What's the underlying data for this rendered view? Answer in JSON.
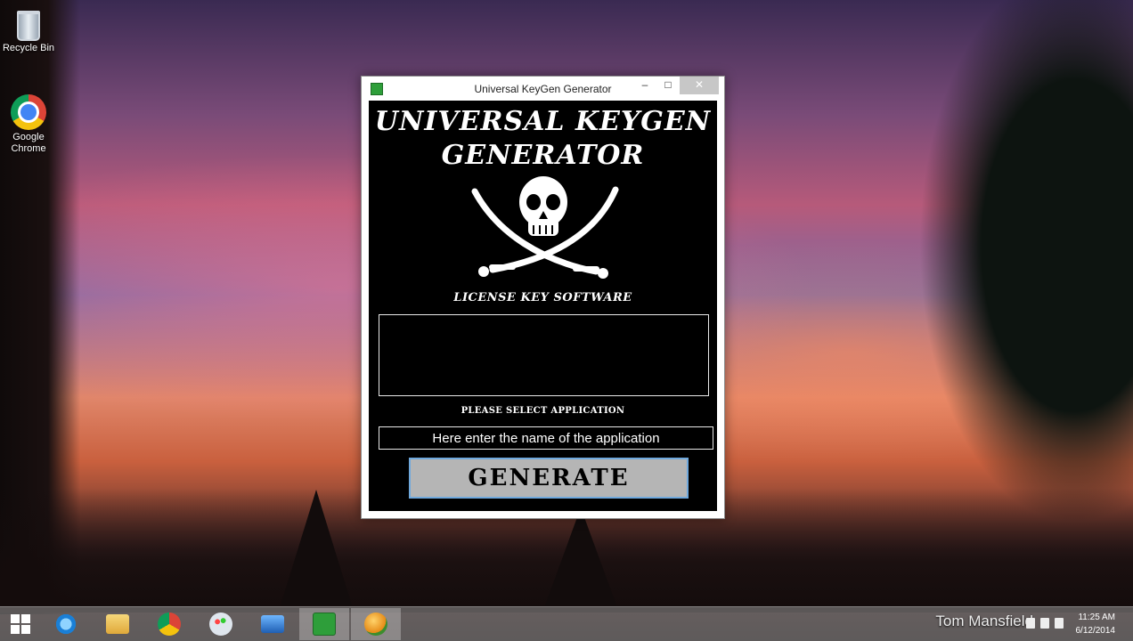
{
  "desktop": {
    "icons": [
      {
        "label": "Recycle Bin",
        "icon": "recycle-bin-icon"
      },
      {
        "label": "Google Chrome",
        "icon": "chrome-icon"
      }
    ]
  },
  "window": {
    "title": "Universal KeyGen Generator",
    "controls": {
      "minimize": "–",
      "maximize": "□",
      "close": "✕"
    },
    "logo_line1": "UNIVERSAL KEYGEN",
    "logo_line2": "GENERATOR",
    "logo_tagline": "LICENSE KEY SOFTWARE",
    "output_value": "",
    "select_label": "PLEASE SELECT APPLICATION",
    "app_input_value": "Here enter the name of the application",
    "generate_label": "GENERATE",
    "accent_color": "#6fa8dc"
  },
  "taskbar": {
    "items": [
      {
        "name": "start",
        "icon": "windows-icon"
      },
      {
        "name": "internet-explorer",
        "icon": "internet-explorer-icon"
      },
      {
        "name": "file-explorer",
        "icon": "folder-icon"
      },
      {
        "name": "chrome",
        "icon": "chrome-icon"
      },
      {
        "name": "paint",
        "icon": "paint-icon"
      },
      {
        "name": "remote-desktop",
        "icon": "computer-icon"
      },
      {
        "name": "keygen-app",
        "icon": "keygen-app-icon",
        "active": true
      },
      {
        "name": "other-app",
        "icon": "globe-app-icon",
        "active": true
      }
    ],
    "user": "Tom Mansfield",
    "time": "11:25 AM",
    "date": "6/12/2014"
  }
}
